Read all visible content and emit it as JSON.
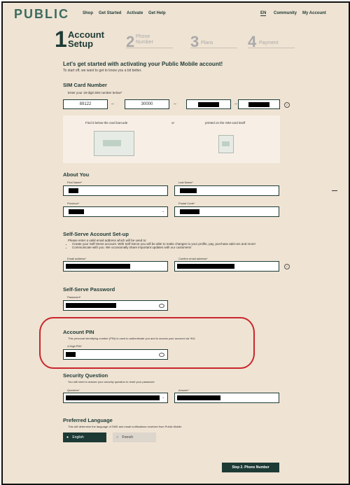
{
  "header": {
    "logo": "PUBLIC",
    "nav": [
      "Shop",
      "Get Started",
      "Activate",
      "Get Help"
    ],
    "lang": "EN",
    "community": "Community",
    "account": "My Account"
  },
  "steps": [
    {
      "num": "1",
      "label1": "Account",
      "label2": "Setup"
    },
    {
      "num": "2",
      "label1": "Phone",
      "label2": "Number"
    },
    {
      "num": "3",
      "label1": "Plans",
      "label2": ""
    },
    {
      "num": "4",
      "label1": "Payment",
      "label2": ""
    }
  ],
  "intro": {
    "heading": "Let's get started with activating your Public Mobile account!",
    "sub": "To start off, we want to get to know you a bit better."
  },
  "sim": {
    "title": "SIM Card Number",
    "instruction": "Enter your 19-digit SIM number below*",
    "part1": "89122",
    "part2": "30000",
    "dash": "–",
    "find_label": "Find it below the card barcode",
    "or": "or",
    "printed_label": "printed on the SIM card itself"
  },
  "about": {
    "title": "About You",
    "first_name_label": "First Name*",
    "last_name_label": "Last Name*",
    "province_label": "Province*",
    "postal_label": "Postal Code*"
  },
  "self_serve": {
    "title": "Self-Serve Account Set-up",
    "intro": "Please enter a valid email address which will be used to:",
    "bullets": [
      "Create your Self-Serve account. With Self-Serve you will be able to make changes to your profile, pay, purchase add-ons and more!",
      "Communicate with you. We occasionally share important updates with our customers!"
    ],
    "email_label": "Email address*",
    "confirm_label": "Confirm email address*"
  },
  "password": {
    "title": "Self-Serve Password",
    "label": "Password*"
  },
  "pin": {
    "title": "Account PIN",
    "desc": "This personal identifying number (PIN) is used to authenticate you and to access your account via *611",
    "label": "4-Digit PIN*"
  },
  "security": {
    "title": "Security Question",
    "desc": "You will need to answer your security question to reset your password",
    "question_label": "Question*",
    "answer_label": "Answer*"
  },
  "language": {
    "title": "Preferred Language",
    "desc": "This will determine the language of SMS and email notifications received from Public Mobile",
    "english": "English",
    "french": "French"
  },
  "cta": "Step 2. Phone Number",
  "colors": {
    "accent": "#1d3a35",
    "background": "#efe3d3",
    "annotation": "#c9262c"
  }
}
